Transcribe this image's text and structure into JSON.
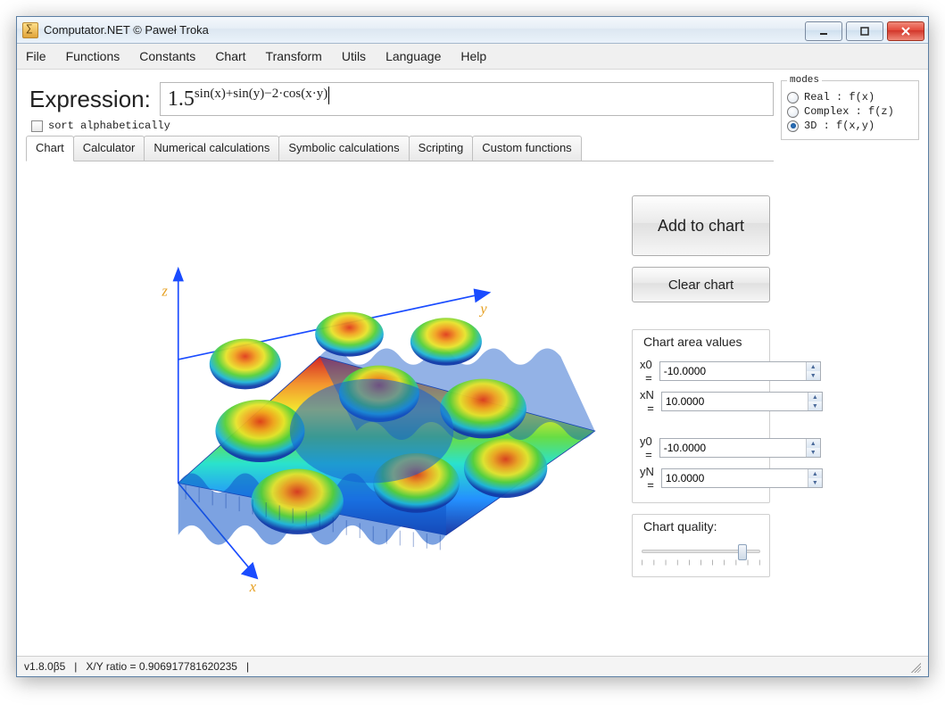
{
  "window": {
    "title": "Computator.NET © Paweł Troka"
  },
  "menu": {
    "items": [
      "File",
      "Functions",
      "Constants",
      "Chart",
      "Transform",
      "Utils",
      "Language",
      "Help"
    ]
  },
  "expression": {
    "label": "Expression:",
    "base": "1.5",
    "exponent": "sin(x)+sin(y)−2·cos(x·y)",
    "sort_label": "sort alphabetically"
  },
  "modes": {
    "legend": "modes",
    "options": [
      {
        "label": "Real : f(x)",
        "checked": false
      },
      {
        "label": "Complex : f(z)",
        "checked": false
      },
      {
        "label": "3D : f(x,y)",
        "checked": true
      }
    ]
  },
  "tabs": [
    "Chart",
    "Calculator",
    "Numerical calculations",
    "Symbolic calculations",
    "Scripting",
    "Custom functions"
  ],
  "active_tab": "Chart",
  "buttons": {
    "add": "Add to chart",
    "clear": "Clear chart"
  },
  "chart_area": {
    "title": "Chart area values",
    "fields": [
      {
        "label": "x0 =",
        "value": "-10.0000"
      },
      {
        "label": "xN =",
        "value": "10.0000"
      },
      {
        "label": "y0 =",
        "value": "-10.0000"
      },
      {
        "label": "yN =",
        "value": "10.0000"
      }
    ],
    "quality_label": "Chart quality:"
  },
  "axes": {
    "x": "x",
    "y": "y",
    "z": "z"
  },
  "status": {
    "version": "v1.8.0β5",
    "ratio_label": "X/Y ratio = 0.906917781620235"
  },
  "chart_data": {
    "type": "surface3d",
    "function": "1.5^(sin(x)+sin(y)-2*cos(x*y))",
    "x_range": [
      -10,
      10
    ],
    "y_range": [
      -10,
      10
    ],
    "z_range_approx": [
      0.198,
      5.06
    ],
    "colormap": "jet",
    "axes_labels": {
      "x": "x",
      "y": "y",
      "z": "z"
    }
  }
}
